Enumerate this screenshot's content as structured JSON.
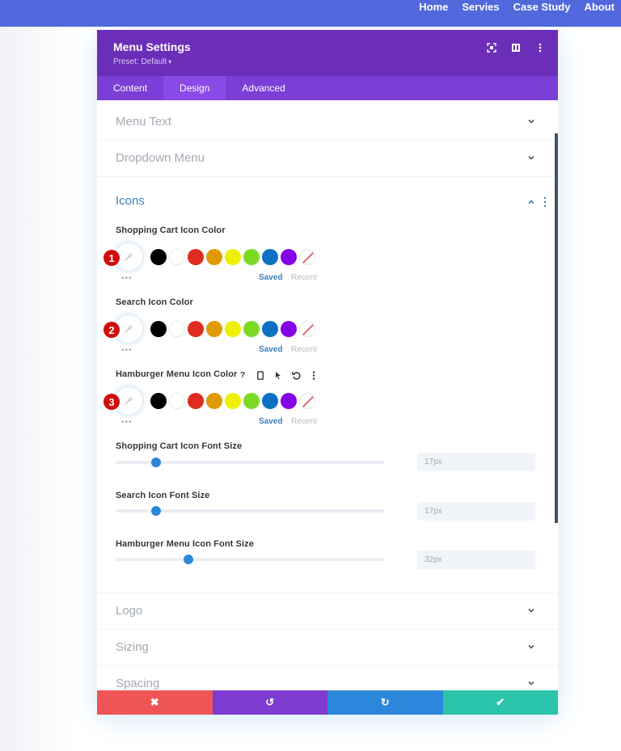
{
  "site_nav": {
    "links": [
      "Home",
      "Servies",
      "Case Study",
      "About"
    ]
  },
  "modal": {
    "title": "Menu Settings",
    "preset": "Preset: Default",
    "header_icons": [
      "focus-icon",
      "split-view-icon",
      "more-vertical-icon"
    ],
    "tabs": [
      {
        "label": "Content",
        "active": false
      },
      {
        "label": "Design",
        "active": true
      },
      {
        "label": "Advanced",
        "active": false
      }
    ],
    "groups_before": [
      {
        "title": "Menu Text",
        "expanded": false
      },
      {
        "title": "Dropdown Menu",
        "expanded": false
      }
    ],
    "icons_group": {
      "title": "Icons",
      "expanded": true,
      "color_fields": [
        {
          "label": "Shopping Cart Icon Color",
          "step_badge": "1"
        },
        {
          "label": "Search Icon Color",
          "step_badge": "2"
        },
        {
          "label": "Hamburger Menu Icon Color",
          "step_badge": "3",
          "hover_icons": [
            "help-icon",
            "mobile-icon",
            "cursor-icon",
            "reset-icon",
            "more-vertical-icon"
          ]
        }
      ],
      "swatches": [
        "#000000",
        "#ffffff",
        "#e02b20",
        "#e09900",
        "#edf000",
        "#7cda24",
        "#0c71c3",
        "#8300e9",
        "none"
      ],
      "palette_tabs": {
        "saved": "Saved",
        "recent": "Recent"
      },
      "size_fields": [
        {
          "label": "Shopping Cart Icon Font Size",
          "value": "17px",
          "slider_fraction": 0.15
        },
        {
          "label": "Search Icon Font Size",
          "value": "17px",
          "slider_fraction": 0.15
        },
        {
          "label": "Hamburger Menu Icon Font Size",
          "value": "32px",
          "slider_fraction": 0.27
        }
      ]
    },
    "groups_after": [
      {
        "title": "Logo",
        "expanded": false
      },
      {
        "title": "Sizing",
        "expanded": false
      },
      {
        "title": "Spacing",
        "expanded": false
      }
    ],
    "footer": {
      "cancel": "✖",
      "undo": "↺",
      "redo": "↻",
      "save": "✔"
    },
    "colors": {
      "header": "#6c2eb9",
      "tabs": "#7b3fd8",
      "cancel": "#ef5555",
      "undo": "#7e3bd0",
      "redo": "#2b87da",
      "save": "#29c4a9"
    }
  }
}
